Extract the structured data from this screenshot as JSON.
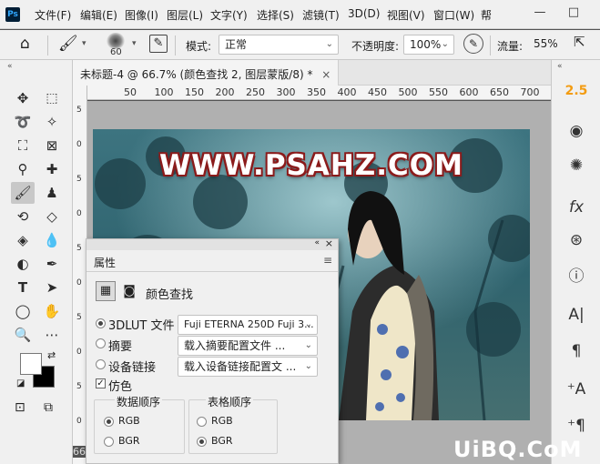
{
  "app": {
    "logo": "Ps"
  },
  "menu": [
    "文件(F)",
    "编辑(E)",
    "图像(I)",
    "图层(L)",
    "文字(Y)",
    "选择(S)",
    "滤镜(T)",
    "3D(D)",
    "视图(V)",
    "窗口(W)",
    "帮"
  ],
  "window_controls": {
    "minimize": "—",
    "maximize": "□"
  },
  "options": {
    "brush_size": "60",
    "mode_label": "模式:",
    "mode_value": "正常",
    "opacity_label": "不透明度:",
    "opacity_value": "100%",
    "flow_label": "流量:",
    "flow_value": "55%"
  },
  "document": {
    "tab_title": "未标题-4 @ 66.7% (颜色查找 2, 图层蒙版/8) *",
    "close": "×",
    "zoom_readout": "66",
    "ruler_ticks": [
      "50",
      "100",
      "150",
      "200",
      "250",
      "300",
      "350",
      "400",
      "450",
      "500",
      "550",
      "600",
      "650",
      "700"
    ],
    "ruler_v_ticks": [
      "5",
      "0",
      "5",
      "0",
      "5",
      "0",
      "5",
      "0",
      "5",
      "0"
    ]
  },
  "image": {
    "overlay_text": "WWW.PSAHZ.COM"
  },
  "right_panel": {
    "top_value": "2.5"
  },
  "properties_panel": {
    "tab": "属性",
    "collapse": "«",
    "close": "×",
    "header_label": "颜色查找",
    "rows": [
      {
        "label": "3DLUT 文件",
        "value": "Fuji ETERNA 250D Fuji 3...",
        "selected": true
      },
      {
        "label": "摘要",
        "value": "载入摘要配置文件 ...",
        "selected": false
      },
      {
        "label": "设备链接",
        "value": "载入设备链接配置文 ...",
        "selected": false
      }
    ],
    "dither_label": "仿色",
    "data_order": {
      "title": "数据顺序",
      "options": [
        "RGB",
        "BGR"
      ],
      "selected": "RGB"
    },
    "table_order": {
      "title": "表格顺序",
      "options": [
        "RGB",
        "BGR"
      ],
      "selected": "BGR"
    }
  },
  "watermark": "UiBQ.CoM",
  "colors": {
    "fg": "#ffffff",
    "bg": "#000000",
    "accent": "#f39c12"
  }
}
